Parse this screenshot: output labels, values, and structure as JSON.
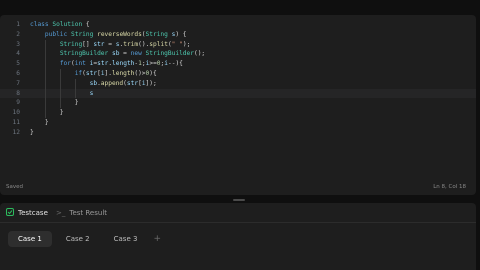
{
  "editor": {
    "lines": [
      {
        "n": "1",
        "code": "class Solution {"
      },
      {
        "n": "2",
        "code": "    public String reverseWords(String s) {"
      },
      {
        "n": "3",
        "code": "        String[] str = s.trim().split(\" \");"
      },
      {
        "n": "4",
        "code": "        StringBuilder sb = new StringBuilder();"
      },
      {
        "n": "5",
        "code": "        for(int i=str.length-1;i>=0;i--){"
      },
      {
        "n": "6",
        "code": "            if(str[i].length()>0){"
      },
      {
        "n": "7",
        "code": "                sb.append(str[i]);"
      },
      {
        "n": "8",
        "code": "                s"
      },
      {
        "n": "9",
        "code": "            }"
      },
      {
        "n": "10",
        "code": "        }"
      },
      {
        "n": "11",
        "code": "    }"
      },
      {
        "n": "12",
        "code": "}"
      }
    ],
    "current_line": 8
  },
  "status": {
    "left": "Saved",
    "right": "Ln 8, Col 18"
  },
  "panel": {
    "testcase_label": "Testcase",
    "test_result_label": "Test Result",
    "cases": [
      "Case 1",
      "Case 2",
      "Case 3"
    ],
    "active_case": "Case 1",
    "add_label": "+"
  },
  "icons": {
    "testcase": "checkbox-icon",
    "test_result": "terminal-icon"
  },
  "colors": {
    "background": "#0f0f0f",
    "editor_bg": "#1e1e1e",
    "testcase_icon": "#2cbb5d"
  }
}
